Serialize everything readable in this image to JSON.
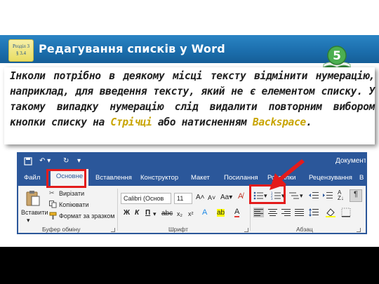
{
  "slide": {
    "title": "Редагування списків у Word",
    "badge_line1": "Розділ 3",
    "badge_line2": "§ 3.4",
    "grade": "5",
    "body": {
      "p1": "Інколи потрібно в деякому місці тексту відмінити нумерацію, наприклад, для введення тексту, який не є елементом списку. У такому випадку нумерацію слід видалити повторним вибором кнопки списку на ",
      "hl1": "Стрічці",
      "p2": " або натисненням ",
      "hl2": "Backspace",
      "p3": "."
    }
  },
  "word": {
    "doc_title": "Документ",
    "tabs": [
      "Файл",
      "Основне",
      "Вставлення",
      "Конструктор",
      "Макет",
      "Посилання",
      "Розсилки",
      "Рецензування",
      "В"
    ],
    "clipboard": {
      "paste": "Вставити",
      "cut": "Вирізати",
      "copy": "Копіювати",
      "format_painter": "Формат за зразком",
      "group": "Буфер обміну"
    },
    "font": {
      "name": "Calibri (Основ",
      "size": "11",
      "bold": "Ж",
      "italic": "К",
      "underline": "П",
      "group": "Шрифт"
    },
    "paragraph": {
      "group": "Абзац"
    }
  },
  "colors": {
    "title_bar": "#1c6fae",
    "word_blue": "#2b579a",
    "highlight": "#c8a400",
    "red_marker": "#e31b1b"
  }
}
